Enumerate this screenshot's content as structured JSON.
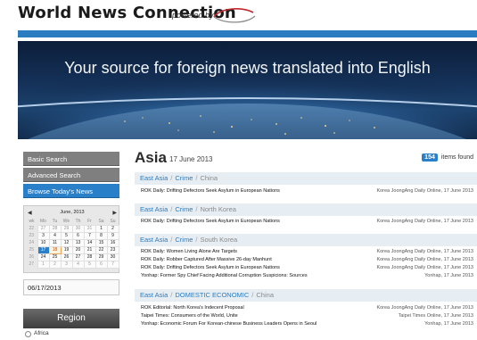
{
  "header": {
    "site_title": "World News Connection",
    "powered_by": "powered by",
    "logo_text": "east view"
  },
  "banner": {
    "tagline": "Your source for foreign news translated into English"
  },
  "sidebar": {
    "nav": [
      {
        "label": "Basic Search"
      },
      {
        "label": "Advanced Search"
      },
      {
        "label": "Browse Today's News"
      }
    ],
    "calendar": {
      "title": "June, 2013",
      "prev": "◀",
      "next": "▶",
      "dow": [
        "wk",
        "Mo",
        "Tu",
        "We",
        "Th",
        "Fr",
        "Sa",
        "Su"
      ],
      "weeks": [
        [
          "22",
          "27",
          "28",
          "29",
          "30",
          "31",
          "1",
          "2"
        ],
        [
          "23",
          "3",
          "4",
          "5",
          "6",
          "7",
          "8",
          "9"
        ],
        [
          "24",
          "10",
          "11",
          "12",
          "13",
          "14",
          "15",
          "16"
        ],
        [
          "25",
          "17",
          "18",
          "19",
          "20",
          "21",
          "22",
          "23"
        ],
        [
          "26",
          "24",
          "25",
          "26",
          "27",
          "28",
          "29",
          "30"
        ],
        [
          "27",
          "1",
          "2",
          "3",
          "4",
          "5",
          "6",
          "7"
        ]
      ]
    },
    "date_value": "06/17/2013",
    "region_title": "Region",
    "region_first": "Africa"
  },
  "main": {
    "title": "Asia",
    "date": "17 June 2013",
    "count": "154",
    "count_suffix": "items found",
    "sections": [
      {
        "region": "East Asia",
        "topic": "Crime",
        "country": "China",
        "rows": [
          {
            "headline": "ROK Daily: Drifting Defectors Seek Asylum in European Nations",
            "source": "Korea JoongAng Daily Online, 17 June 2013"
          }
        ]
      },
      {
        "region": "East Asia",
        "topic": "Crime",
        "country": "North Korea",
        "rows": [
          {
            "headline": "ROK Daily: Drifting Defectors Seek Asylum in European Nations",
            "source": "Korea JoongAng Daily Online, 17 June 2013"
          }
        ]
      },
      {
        "region": "East Asia",
        "topic": "Crime",
        "country": "South Korea",
        "rows": [
          {
            "headline": "ROK Daily: Women Living Alone Are Targets",
            "source": "Korea JoongAng Daily Online, 17 June 2013"
          },
          {
            "headline": "ROK Daily: Robber Captured After Massive 26-day Manhunt",
            "source": "Korea JoongAng Daily Online, 17 June 2013"
          },
          {
            "headline": "ROK Daily: Drifting Defectors Seek Asylum in European Nations",
            "source": "Korea JoongAng Daily Online, 17 June 2013"
          },
          {
            "headline": "Yonhap: Former Spy Chief Facing Additional Corruption Suspicions: Sources",
            "source": "Yonhap, 17 June 2013"
          }
        ]
      },
      {
        "region": "East Asia",
        "topic": "DOMESTIC ECONOMIC",
        "country": "China",
        "rows": [
          {
            "headline": "ROK Editorial: North Korea's Indecent Proposal",
            "source": "Korea JoongAng Daily Online, 17 June 2013"
          },
          {
            "headline": "Taipei Times: Consumers of the World, Unite",
            "source": "Taipei Times Online, 17 June 2013"
          },
          {
            "headline": "Yonhap: Economic Forum For Korean-chinese Business Leaders Opens in Seoul",
            "source": "Yonhap, 17 June 2013"
          }
        ]
      }
    ]
  },
  "colors": {
    "accent_blue": "#2a7cc1",
    "nav_gray": "#7f7f7f",
    "section_bg": "#e6edf3",
    "logo_red": "#c0282d"
  }
}
